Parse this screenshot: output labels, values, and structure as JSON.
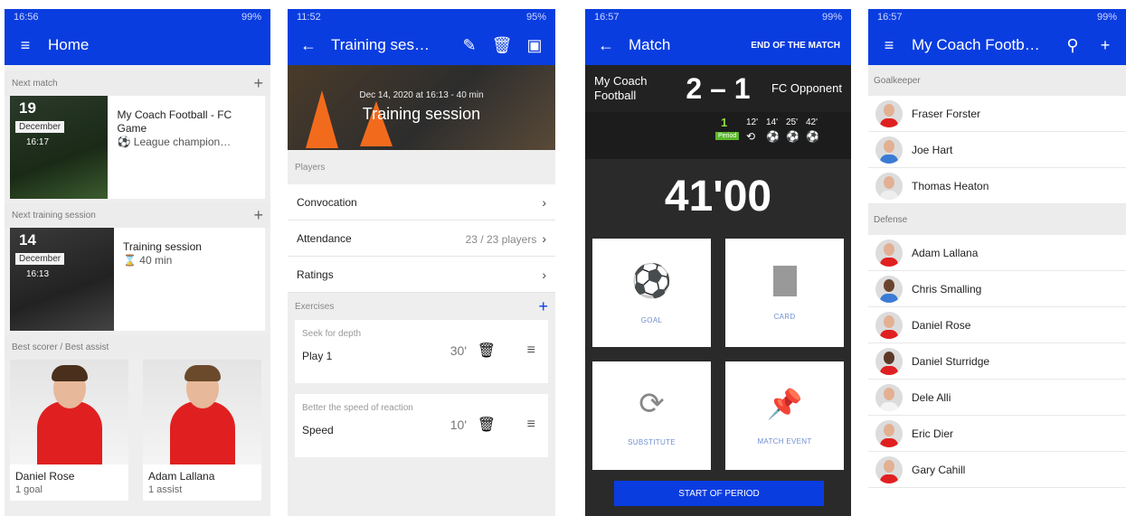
{
  "colors": {
    "primary": "#0a3de0",
    "red_shirt": "#e02020",
    "cone": "#f26b1d"
  },
  "home": {
    "status": {
      "time": "16:56",
      "battery": "99%"
    },
    "title": "Home",
    "next_match": {
      "section": "Next match",
      "day": "19",
      "month": "December",
      "time": "16:17",
      "name": "My Coach Football - FC Game",
      "competition": "League champion…"
    },
    "next_training": {
      "section": "Next training session",
      "day": "14",
      "month": "December",
      "time": "16:13",
      "name": "Training session",
      "duration": "40 min"
    },
    "best": {
      "section": "Best scorer / Best assist",
      "players": [
        {
          "name": "Daniel Rose",
          "stat": "1 goal"
        },
        {
          "name": "Adam Lallana",
          "stat": "1 assist"
        }
      ]
    }
  },
  "training": {
    "status": {
      "time": "11:52",
      "battery": "95%"
    },
    "title": "Training ses…",
    "hero_date": "Dec 14, 2020 at 16:13 - 40 min",
    "hero_title": "Training session",
    "players_label": "Players",
    "rows": [
      {
        "label": "Convocation",
        "right": ""
      },
      {
        "label": "Attendance",
        "right": "23 / 23 players"
      },
      {
        "label": "Ratings",
        "right": ""
      }
    ],
    "exercises_label": "Exercises",
    "exercises": [
      {
        "theme": "Seek for depth",
        "name": "Play 1",
        "duration": "30'"
      },
      {
        "theme": "Better the speed of reaction",
        "name": "Speed",
        "duration": "10'"
      }
    ]
  },
  "match": {
    "status": {
      "time": "16:57",
      "battery": "99%"
    },
    "title": "Match",
    "end_label": "END OF THE MATCH",
    "home_team": "My Coach Football",
    "away_team": "FC Opponent",
    "home_score": "2",
    "away_score": "1",
    "period_number": "1",
    "period_label": "Period",
    "event_minutes": [
      "12'",
      "14'",
      "25'",
      "42'"
    ],
    "clock": "41'00",
    "tiles": [
      "GOAL",
      "CARD",
      "SUBSTITUTE",
      "MATCH EVENT"
    ],
    "start_label": "START OF PERIOD"
  },
  "squad": {
    "status": {
      "time": "16:57",
      "battery": "99%"
    },
    "title": "My Coach Footb…",
    "groups": [
      {
        "label": "Goalkeeper",
        "players": [
          "Fraser Forster",
          "Joe Hart",
          "Thomas Heaton"
        ]
      },
      {
        "label": "Defense",
        "players": [
          "Adam Lallana",
          "Chris Smalling",
          "Daniel Rose",
          "Daniel Sturridge",
          "Dele Alli",
          "Eric Dier",
          "Gary Cahill"
        ]
      }
    ]
  }
}
